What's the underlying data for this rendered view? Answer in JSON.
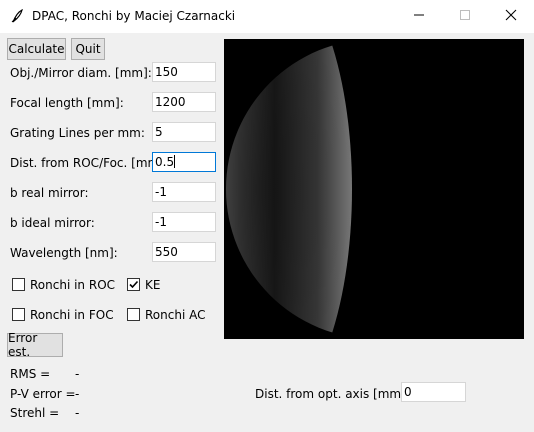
{
  "window": {
    "title": "DPAC, Ronchi by Maciej Czarnacki",
    "icons": {
      "app": "feather-icon",
      "minimize": "minimize-icon",
      "maximize": "maximize-icon",
      "close": "close-icon"
    }
  },
  "toolbar": {
    "calculate_label": "Calculate",
    "quit_label": "Quit"
  },
  "fields": [
    {
      "label": "Obj./Mirror diam. [mm]:",
      "value": "150"
    },
    {
      "label": "Focal length [mm]:",
      "value": "1200"
    },
    {
      "label": "Grating Lines per mm:",
      "value": "5"
    },
    {
      "label": "Dist. from ROC/Foc. [mm]:",
      "value": "0.5"
    },
    {
      "label": "b real mirror:",
      "value": "-1"
    },
    {
      "label": "b ideal mirror:",
      "value": "-1"
    },
    {
      "label": "Wavelength [nm]:",
      "value": "550"
    }
  ],
  "checkboxes": [
    {
      "label": "Ronchi in ROC",
      "checked": false
    },
    {
      "label": "KE",
      "checked": true
    },
    {
      "label": "Ronchi in FOC",
      "checked": false
    },
    {
      "label": "Ronchi AC",
      "checked": false
    }
  ],
  "error_button_label": "Error est.",
  "results": [
    {
      "label": "RMS =",
      "value": "-"
    },
    {
      "label": "P-V error =",
      "value": "-"
    },
    {
      "label": "Strehl =",
      "value": "-"
    }
  ],
  "axis_distance": {
    "label": "Dist. from opt. axis [mm]:",
    "value": "0"
  },
  "colors": {
    "canvas_background": "#000000",
    "window_background": "#f0f0f0",
    "titlebar": "#ffffff"
  }
}
